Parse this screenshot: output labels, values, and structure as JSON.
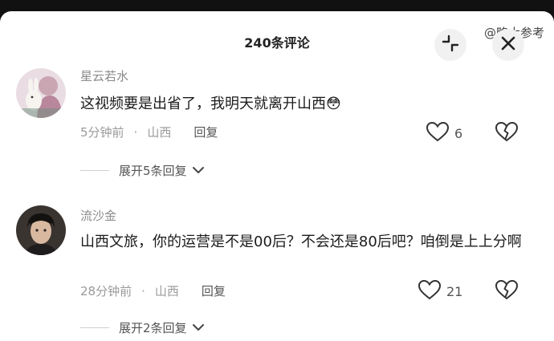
{
  "header": {
    "title": "240条评论",
    "watermark": "@略大参考"
  },
  "comments": [
    {
      "username": "星云若水",
      "content": "这视频要是出省了，我明天就离开山西😳",
      "time": "5分钟前",
      "location": "山西",
      "reply_label": "回复",
      "likes": "6",
      "expand_label": "展开5条回复"
    },
    {
      "username": "流沙金",
      "content": "山西文旅，你的运营是不是00后？不会还是80后吧？咱倒是上上分啊",
      "time": "28分钟前",
      "location": "山西",
      "reply_label": "回复",
      "likes": "21",
      "expand_label": "展开2条回复"
    }
  ],
  "separator_dot": "·",
  "colors": {
    "background": "#ffffff",
    "username": "#8a8a8a",
    "meta": "#9a9a9a",
    "text": "#1c1c1c"
  },
  "icons": [
    "collapse-icon",
    "close-icon",
    "heart-icon",
    "broken-heart-icon",
    "chevron-down-icon"
  ]
}
